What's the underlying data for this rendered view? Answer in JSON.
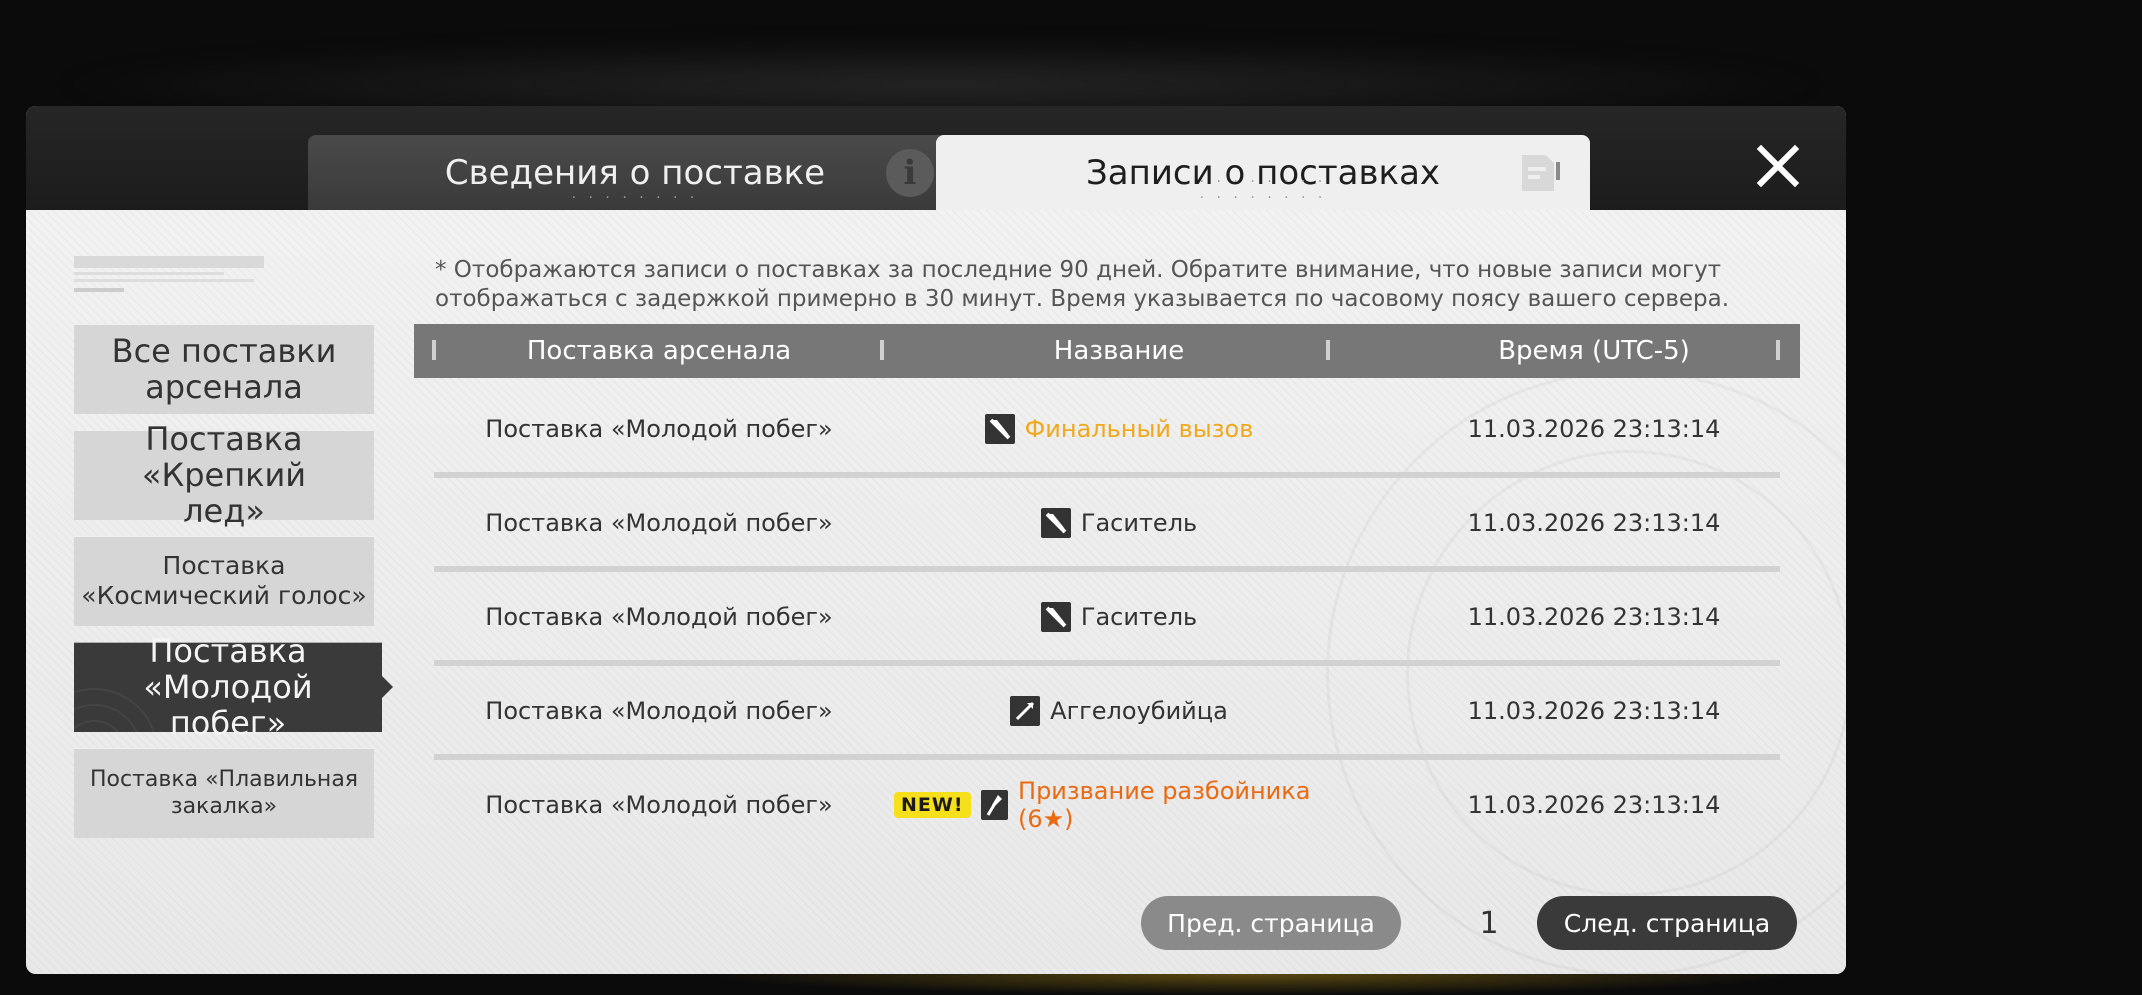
{
  "tabs": [
    {
      "label": "Сведения о поставке",
      "icon": "info-icon"
    },
    {
      "label": "Записи о поставках",
      "icon": "document-icon"
    }
  ],
  "notice": "* Отображаются записи о поставках за последние 90 дней. Обратите внимание, что новые записи могут отображаться с задержкой примерно в 30 минут. Время указывается по часовому поясу вашего сервера.",
  "sidebar": {
    "items": [
      {
        "label": "Все поставки арсенала",
        "active": false
      },
      {
        "label": "Поставка «Крепкий лед»",
        "active": false
      },
      {
        "label": "Поставка «Космический голос»",
        "active": false
      },
      {
        "label": "Поставка «Молодой побег»",
        "active": true
      },
      {
        "label": "Поставка «Плавильная закалка»",
        "active": false
      }
    ]
  },
  "table": {
    "headers": [
      "Поставка арсенала",
      "Название",
      "Время (UTC-5)"
    ],
    "rows": [
      {
        "supply": "Поставка «Молодой побег»",
        "name": "Финальный вызов",
        "time": "11.03.2026 23:13:14",
        "color": "#f0a81c",
        "new": ""
      },
      {
        "supply": "Поставка «Молодой побег»",
        "name": "Гаситель",
        "time": "11.03.2026 23:13:14",
        "color": "#333333",
        "new": ""
      },
      {
        "supply": "Поставка «Молодой побег»",
        "name": "Гаситель",
        "time": "11.03.2026 23:13:14",
        "color": "#333333",
        "new": ""
      },
      {
        "supply": "Поставка «Молодой побег»",
        "name": "Аггелоубийца",
        "time": "11.03.2026 23:13:14",
        "color": "#333333",
        "new": ""
      },
      {
        "supply": "Поставка «Молодой побег»",
        "name": "Призвание разбойника (6★)",
        "time": "11.03.2026 23:13:14",
        "color": "#ea6a12",
        "new": "NEW!"
      }
    ]
  },
  "pager": {
    "prev_label": "Пред. страница",
    "next_label": "След. страница",
    "page": "1"
  },
  "colors": {
    "accent_orange": "#ea6a12",
    "accent_gold": "#f0a81c",
    "new_badge": "#f6df1b"
  }
}
